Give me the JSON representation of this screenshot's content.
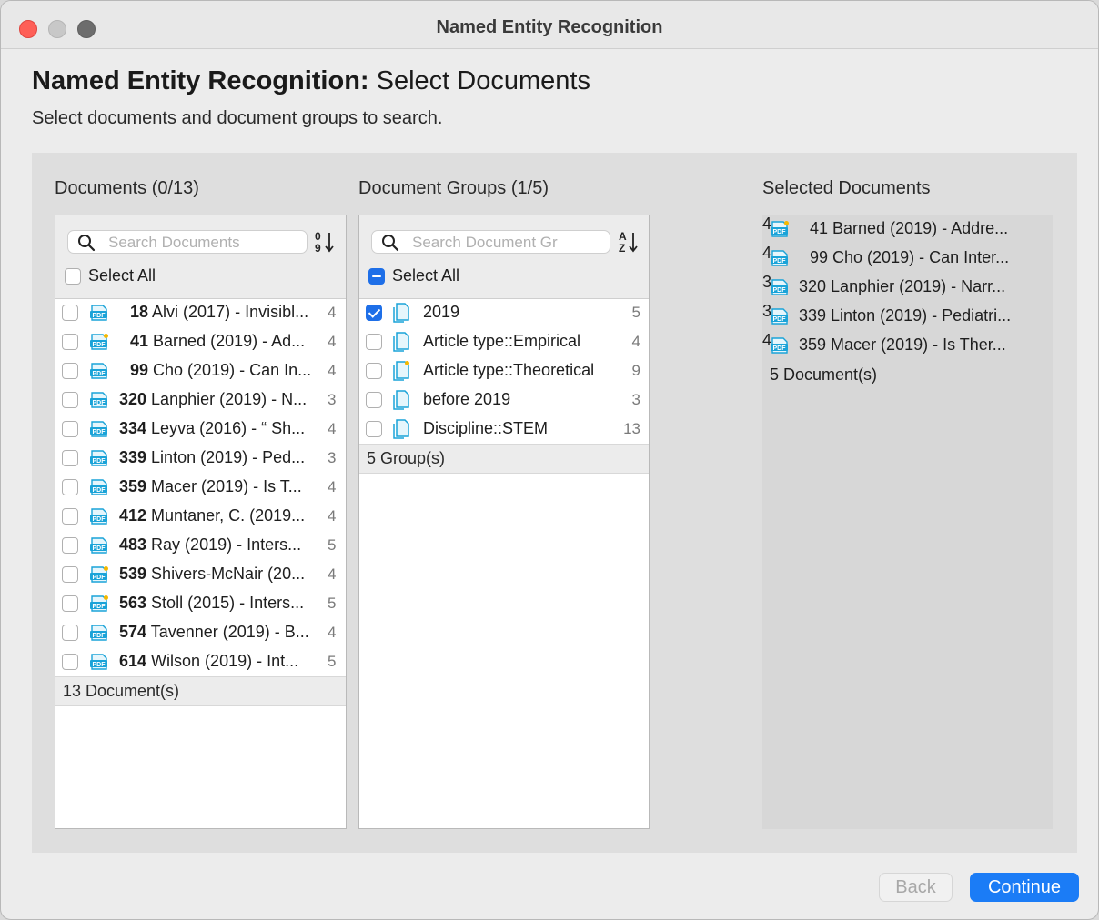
{
  "window": {
    "title": "Named Entity Recognition",
    "traffic_lights": [
      "close-icon",
      "minimize-icon",
      "maximize-icon"
    ]
  },
  "header": {
    "title_bold": "Named Entity Recognition:",
    "title_rest": " Select Documents",
    "subtitle": "Select documents and document groups to search."
  },
  "documents": {
    "title": "Documents (0/13)",
    "search_placeholder": "Search Documents",
    "sort_icon": "sort-numeric-icon",
    "select_all_label": "Select All",
    "select_all_checked": false,
    "items": [
      {
        "num": "18",
        "text": " Alvi (2017) - Invisibl...",
        "count": "4",
        "checked": false,
        "badge": false
      },
      {
        "num": "41",
        "text": " Barned (2019) - Ad...",
        "count": "4",
        "checked": false,
        "badge": true
      },
      {
        "num": "99",
        "text": " Cho (2019) - Can In...",
        "count": "4",
        "checked": false,
        "badge": false
      },
      {
        "num": "320",
        "text": " Lanphier (2019) - N...",
        "count": "3",
        "checked": false,
        "badge": false
      },
      {
        "num": "334",
        "text": " Leyva (2016) - “ Sh...",
        "count": "4",
        "checked": false,
        "badge": false
      },
      {
        "num": "339",
        "text": " Linton (2019) - Ped...",
        "count": "3",
        "checked": false,
        "badge": false
      },
      {
        "num": "359",
        "text": " Macer (2019) - Is T...",
        "count": "4",
        "checked": false,
        "badge": false
      },
      {
        "num": "412",
        "text": " Muntaner, C. (2019...",
        "count": "4",
        "checked": false,
        "badge": false
      },
      {
        "num": "483",
        "text": " Ray (2019) - Inters...",
        "count": "5",
        "checked": false,
        "badge": false
      },
      {
        "num": "539",
        "text": " Shivers-McNair (20...",
        "count": "4",
        "checked": false,
        "badge": true
      },
      {
        "num": "563",
        "text": " Stoll (2015) - Inters...",
        "count": "5",
        "checked": false,
        "badge": true
      },
      {
        "num": "574",
        "text": " Tavenner (2019) - B...",
        "count": "4",
        "checked": false,
        "badge": false
      },
      {
        "num": "614",
        "text": " Wilson (2019) - Int...",
        "count": "5",
        "checked": false,
        "badge": false
      }
    ],
    "footer": "13 Document(s)"
  },
  "groups": {
    "title": "Document Groups (1/5)",
    "search_placeholder": "Search Document Gro",
    "sort_icon": "sort-alpha-icon",
    "select_all_label": "Select All",
    "select_all_state": "mixed",
    "items": [
      {
        "name": "2019",
        "count": "5",
        "checked": true,
        "badge": false
      },
      {
        "name": "Article type::Empirical",
        "count": "4",
        "checked": false,
        "badge": false
      },
      {
        "name": "Article type::Theoretical",
        "count": "9",
        "checked": false,
        "badge": true
      },
      {
        "name": "before 2019",
        "count": "3",
        "checked": false,
        "badge": false
      },
      {
        "name": "Discipline::STEM",
        "count": "13",
        "checked": false,
        "badge": false
      }
    ],
    "footer": "5 Group(s)"
  },
  "selected": {
    "title": "Selected Documents",
    "items": [
      {
        "num": "41",
        "text": " Barned (2019) - Addre...",
        "count": "4",
        "badge": true
      },
      {
        "num": "99",
        "text": " Cho (2019) - Can Inter...",
        "count": "4",
        "badge": false
      },
      {
        "num": "320",
        "text": " Lanphier (2019) - Narr...",
        "count": "3",
        "badge": false
      },
      {
        "num": "339",
        "text": " Linton (2019) - Pediatri...",
        "count": "3",
        "badge": false
      },
      {
        "num": "359",
        "text": " Macer (2019) - Is Ther...",
        "count": "4",
        "badge": false
      }
    ],
    "footer": "5 Document(s)"
  },
  "buttons": {
    "back": "Back",
    "continue": "Continue"
  },
  "colors": {
    "accent": "#1b7cf6",
    "pdf_icon": "#1aa3d8",
    "badge": "#f5b800"
  }
}
